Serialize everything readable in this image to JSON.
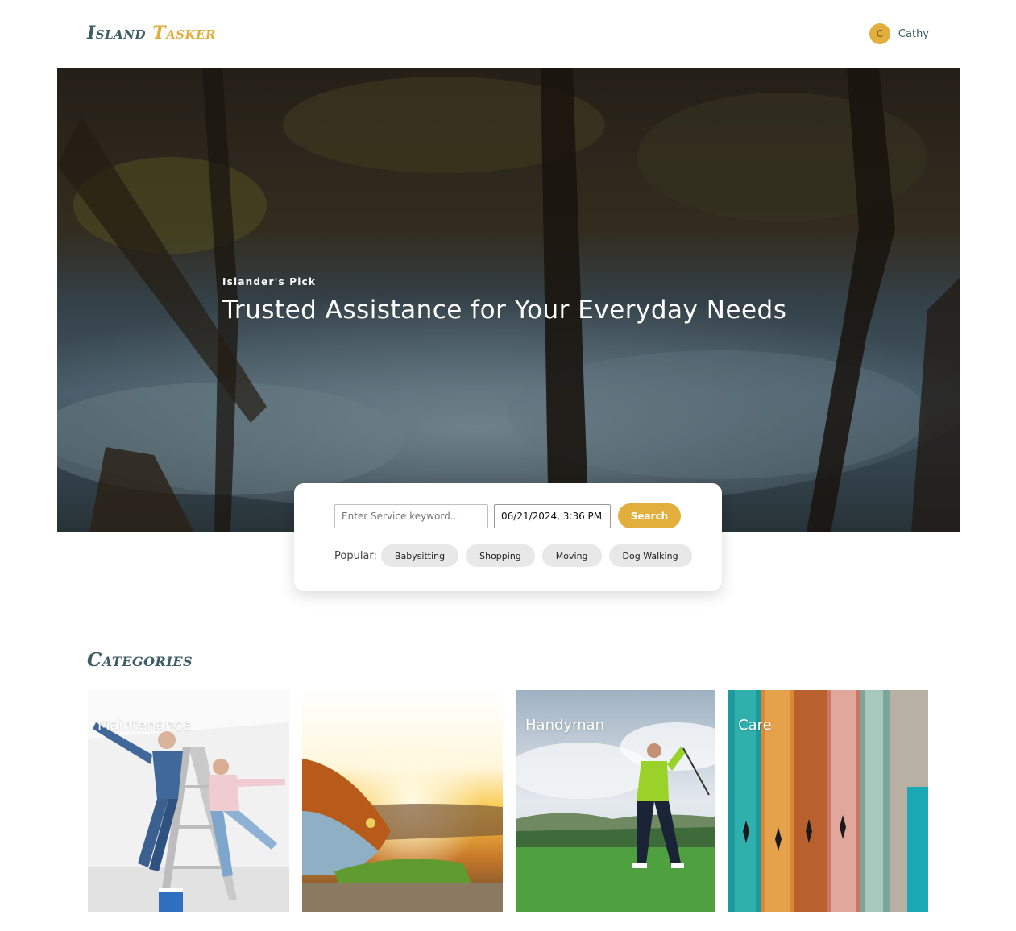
{
  "brand": {
    "word1": "Island",
    "word2": "Tasker"
  },
  "user": {
    "initial": "C",
    "name": "Cathy"
  },
  "hero": {
    "kicker": "Islander's Pick",
    "title": "Trusted Assistance for Your Everyday Needs"
  },
  "search": {
    "keyword_placeholder": "Enter Service keyword...",
    "keyword_value": "",
    "datetime_value": "06/21/2024, 3:36 PM",
    "button_label": "Search",
    "popular_label": "Popular:",
    "popular_tags": [
      "Babysitting",
      "Shopping",
      "Moving",
      "Dog Walking"
    ]
  },
  "categories": {
    "heading": "Categories",
    "items": [
      {
        "label": "Maintenance",
        "image": "couple-painting-ladder"
      },
      {
        "label": "",
        "image": "tent-sunset"
      },
      {
        "label": "Handyman",
        "image": "golfer-swing"
      },
      {
        "label": "Care",
        "image": "surfboards"
      }
    ]
  },
  "colors": {
    "accent": "#e2ae3c",
    "brand_dark": "#3d5c66",
    "chip_bg": "#e8e8e8"
  },
  "icons": {
    "avatar": "user-avatar-initial"
  }
}
